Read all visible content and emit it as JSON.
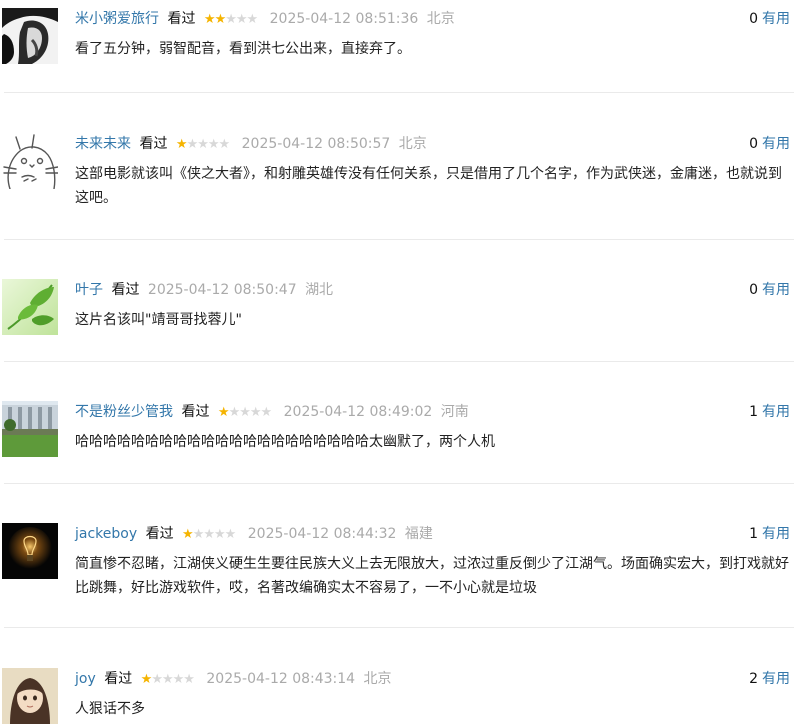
{
  "comments": [
    {
      "user": "米小粥爱旅行",
      "status": "看过",
      "rating": 2,
      "time": "2025-04-12 08:51:36",
      "location": "北京",
      "votes": "0",
      "vote_label": "有用",
      "text": "看了五分钟，弱智配音，看到洪七公出来，直接弃了。",
      "avatar": "bw-portrait"
    },
    {
      "user": "未来未来",
      "status": "看过",
      "rating": 1,
      "time": "2025-04-12 08:50:57",
      "location": "北京",
      "votes": "0",
      "vote_label": "有用",
      "text": "这部电影就该叫《侠之大者》，和射雕英雄传没有任何关系，只是借用了几个名字，作为武侠迷，金庸迷，也就说到这吧。",
      "avatar": "totoro-sketch"
    },
    {
      "user": "叶子",
      "status": "看过",
      "rating": 0,
      "time": "2025-04-12 08:50:47",
      "location": "湖北",
      "votes": "0",
      "vote_label": "有用",
      "text": "这片名该叫\"靖哥哥找蓉儿\"",
      "avatar": "green-leaf"
    },
    {
      "user": "不是粉丝少管我",
      "status": "看过",
      "rating": 1,
      "time": "2025-04-12 08:49:02",
      "location": "河南",
      "votes": "1",
      "vote_label": "有用",
      "text": "哈哈哈哈哈哈哈哈哈哈哈哈哈哈哈哈哈哈哈哈哈太幽默了，两个人机",
      "avatar": "building-lawn"
    },
    {
      "user": "jackeboy",
      "status": "看过",
      "rating": 1,
      "time": "2025-04-12 08:44:32",
      "location": "福建",
      "votes": "1",
      "vote_label": "有用",
      "text": "简直惨不忍睹，江湖侠义硬生生要往民族大义上去无限放大，过浓过重反倒少了江湖气。场面确实宏大，到打戏就好比跳舞，好比游戏软件，哎，名著改编确实太不容易了，一不小心就是垃圾",
      "avatar": "light-bulb"
    },
    {
      "user": "joy",
      "status": "看过",
      "rating": 1,
      "time": "2025-04-12 08:43:14",
      "location": "北京",
      "votes": "2",
      "vote_label": "有用",
      "text": "人狠话不多",
      "avatar": "anime-girl"
    }
  ]
}
